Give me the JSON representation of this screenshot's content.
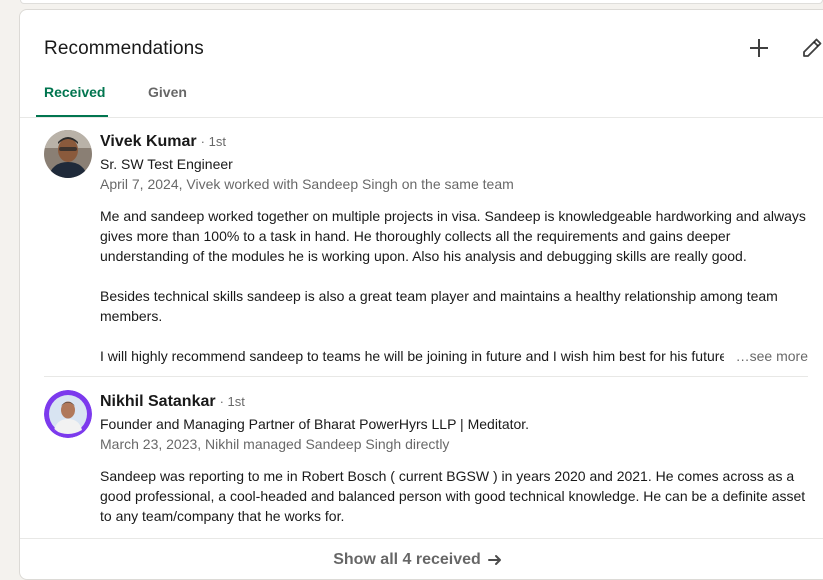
{
  "section": {
    "title": "Recommendations",
    "add_icon": "plus-icon",
    "edit_icon": "pencil-icon"
  },
  "tabs": [
    {
      "label": "Received",
      "active": true
    },
    {
      "label": "Given",
      "active": false
    }
  ],
  "recommendations": [
    {
      "name": "Vivek Kumar",
      "degree": "· 1st",
      "headline": "Sr. SW Test Engineer",
      "meta": "April 7, 2024, Vivek worked with Sandeep Singh on the same team",
      "paragraphs": [
        "Me and sandeep worked together on multiple projects in visa. Sandeep is knowledgeable hardworking and always gives more than 100% to a task in hand. He thoroughly collects all the requirements and gains deeper understanding of the modules he is working upon. Also his analysis and debugging skills are really good.",
        "Besides technical skills sandeep is also a great team player and maintains a healthy relationship among team members.",
        "I will highly recommend sandeep to teams he will be joining in future and I wish him best for his future"
      ],
      "see_more": "…see more"
    },
    {
      "name": "Nikhil Satankar",
      "degree": "· 1st",
      "headline": "Founder and Managing Partner of Bharat PowerHyrs LLP | Meditator.",
      "meta": "March 23, 2023, Nikhil managed Sandeep Singh directly",
      "paragraphs": [
        "Sandeep was reporting to me in Robert Bosch ( current BGSW ) in years 2020 and 2021. He comes across as a good professional, a cool-headed and balanced person with good technical knowledge. He can be a definite asset to any team/company that he works for."
      ]
    }
  ],
  "footer": {
    "show_all_label": "Show all 4 received",
    "arrow_icon": "arrow-right-icon"
  },
  "colors": {
    "accent": "#01754f",
    "open_to_work_ring": "#7c3aed"
  }
}
